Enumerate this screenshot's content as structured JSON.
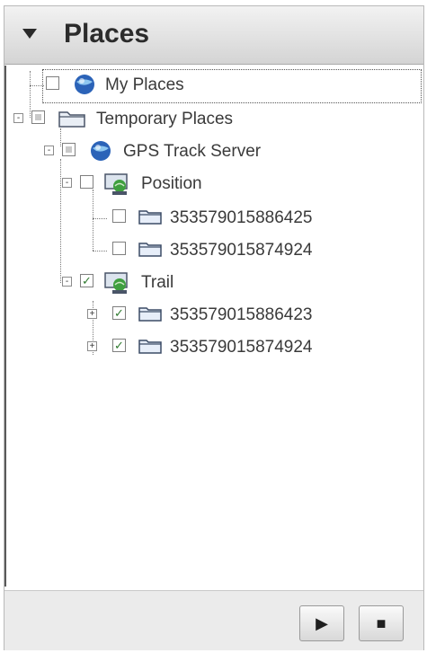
{
  "panel": {
    "title": "Places"
  },
  "tree": [
    {
      "label": "My Places",
      "checkbox": "unchecked",
      "icon": "globe-icon"
    },
    {
      "label": "Temporary Places",
      "checkbox": "partial",
      "icon": "temporary-folder-icon",
      "expander": "-"
    },
    {
      "label": "GPS Track Server",
      "checkbox": "partial",
      "icon": "globe-icon",
      "expander": "-"
    },
    {
      "label": "Position",
      "checkbox": "unchecked",
      "icon": "network-link-icon",
      "expander": "-"
    },
    {
      "label": "353579015886425",
      "checkbox": "unchecked",
      "icon": "folder-icon"
    },
    {
      "label": "353579015874924",
      "checkbox": "unchecked",
      "icon": "folder-icon"
    },
    {
      "label": "Trail",
      "checkbox": "checked",
      "icon": "network-link-icon",
      "expander": "-"
    },
    {
      "label": "353579015886423",
      "checkbox": "checked",
      "icon": "folder-icon",
      "expander": "+"
    },
    {
      "label": "353579015874924",
      "checkbox": "checked",
      "icon": "folder-icon",
      "expander": "+"
    }
  ],
  "footer": {
    "play_label": "▶",
    "stop_label": "■"
  }
}
